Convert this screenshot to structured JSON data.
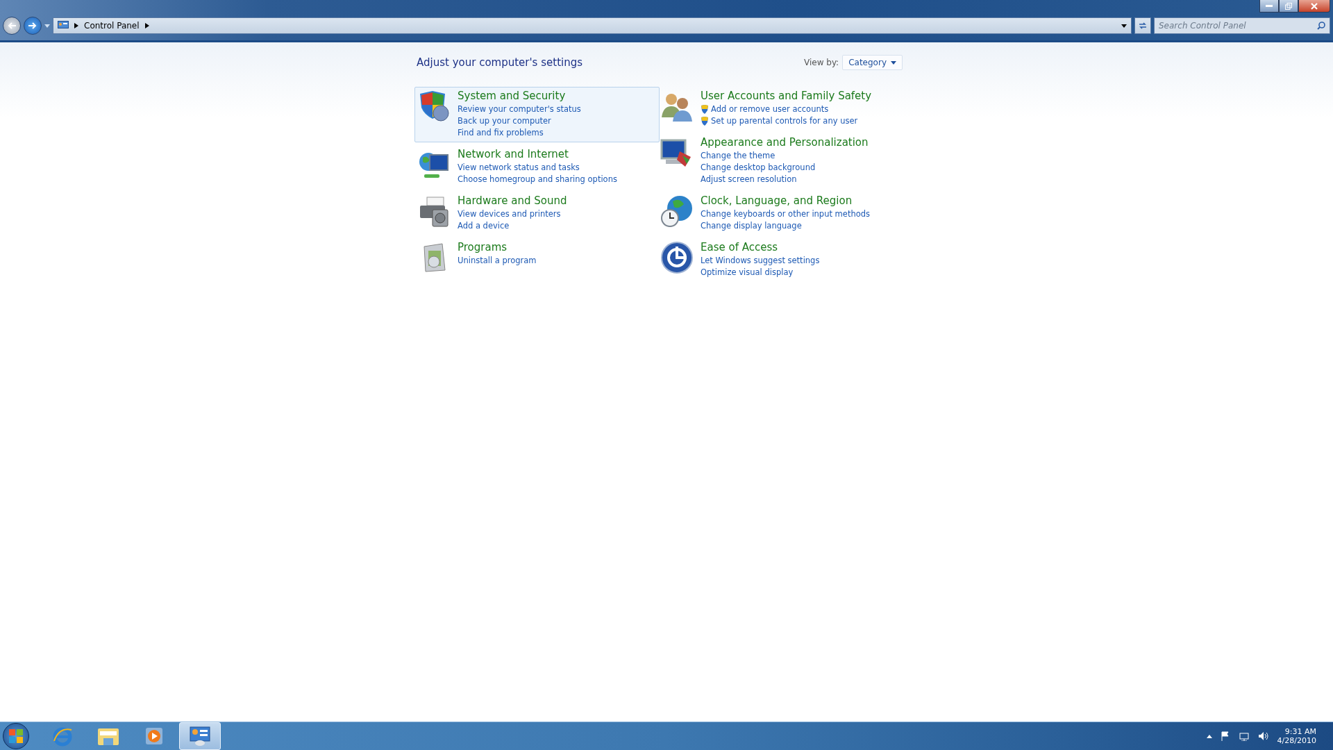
{
  "address_bar": {
    "path": [
      "Control Panel"
    ],
    "search_placeholder": "Search Control Panel"
  },
  "heading": "Adjust your computer's settings",
  "view_by": {
    "label": "View by:",
    "value": "Category"
  },
  "columns": [
    {
      "categories": [
        {
          "title": "System and Security",
          "kind": "shield",
          "selected": true,
          "links": [
            {
              "text": "Review your computer's status",
              "admin": false
            },
            {
              "text": "Back up your computer",
              "admin": false
            },
            {
              "text": "Find and fix problems",
              "admin": false
            }
          ]
        },
        {
          "title": "Network and Internet",
          "kind": "network",
          "selected": false,
          "links": [
            {
              "text": "View network status and tasks",
              "admin": false
            },
            {
              "text": "Choose homegroup and sharing options",
              "admin": false
            }
          ]
        },
        {
          "title": "Hardware and Sound",
          "kind": "printer",
          "selected": false,
          "links": [
            {
              "text": "View devices and printers",
              "admin": false
            },
            {
              "text": "Add a device",
              "admin": false
            }
          ]
        },
        {
          "title": "Programs",
          "kind": "programs",
          "selected": false,
          "links": [
            {
              "text": "Uninstall a program",
              "admin": false
            }
          ]
        }
      ]
    },
    {
      "categories": [
        {
          "title": "User Accounts and Family Safety",
          "kind": "users",
          "selected": false,
          "links": [
            {
              "text": "Add or remove user accounts",
              "admin": true
            },
            {
              "text": "Set up parental controls for any user",
              "admin": true
            }
          ]
        },
        {
          "title": "Appearance and Personalization",
          "kind": "monitor",
          "selected": false,
          "links": [
            {
              "text": "Change the theme",
              "admin": false
            },
            {
              "text": "Change desktop background",
              "admin": false
            },
            {
              "text": "Adjust screen resolution",
              "admin": false
            }
          ]
        },
        {
          "title": "Clock, Language, and Region",
          "kind": "globe",
          "selected": false,
          "links": [
            {
              "text": "Change keyboards or other input methods",
              "admin": false
            },
            {
              "text": "Change display language",
              "admin": false
            }
          ]
        },
        {
          "title": "Ease of Access",
          "kind": "access",
          "selected": false,
          "links": [
            {
              "text": "Let Windows suggest settings",
              "admin": false
            },
            {
              "text": "Optimize visual display",
              "admin": false
            }
          ]
        }
      ]
    }
  ],
  "taskbar": {
    "apps": [
      {
        "kind": "browser",
        "selected": false
      },
      {
        "kind": "folder",
        "selected": false
      },
      {
        "kind": "media",
        "selected": false
      },
      {
        "kind": "control-panel",
        "selected": true
      }
    ],
    "time": "9:31 AM",
    "date": "4/28/2010"
  }
}
